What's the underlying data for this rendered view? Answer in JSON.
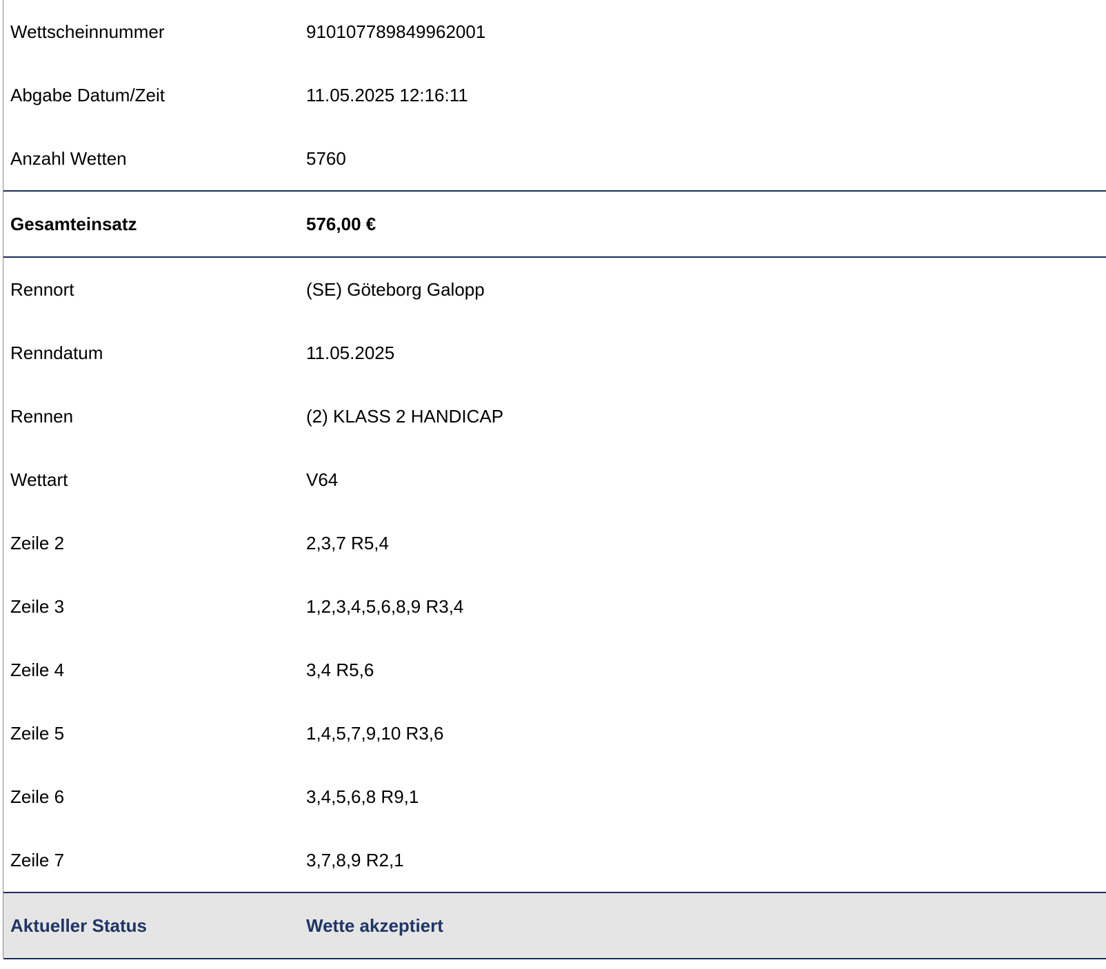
{
  "ticket": {
    "header_rows": [
      {
        "label": "Wettscheinnummer",
        "value": "910107789849962001"
      },
      {
        "label": "Abgabe Datum/Zeit",
        "value": "11.05.2025 12:16:11"
      },
      {
        "label": "Anzahl Wetten",
        "value": "5760"
      }
    ],
    "total": {
      "label": "Gesamteinsatz",
      "value": "576,00 €"
    },
    "detail_rows": [
      {
        "label": "Rennort",
        "value": "(SE) Göteborg Galopp"
      },
      {
        "label": "Renndatum",
        "value": "11.05.2025"
      },
      {
        "label": "Rennen",
        "value": "(2) KLASS 2 HANDICAP"
      },
      {
        "label": "Wettart",
        "value": "V64"
      },
      {
        "label": "Zeile 2",
        "value": "2,3,7 R5,4"
      },
      {
        "label": "Zeile 3",
        "value": "1,2,3,4,5,6,8,9 R3,4"
      },
      {
        "label": "Zeile 4",
        "value": "3,4 R5,6"
      },
      {
        "label": "Zeile 5",
        "value": "1,4,5,7,9,10 R3,6"
      },
      {
        "label": "Zeile 6",
        "value": "3,4,5,6,8 R9,1"
      },
      {
        "label": "Zeile 7",
        "value": "3,7,8,9 R2,1"
      }
    ],
    "status": {
      "label": "Aktueller Status",
      "value": "Wette akzeptiert"
    }
  },
  "colors": {
    "rule": "#1a2c5a",
    "status_text": "#1f3566",
    "status_background": "#e5e5e5"
  }
}
